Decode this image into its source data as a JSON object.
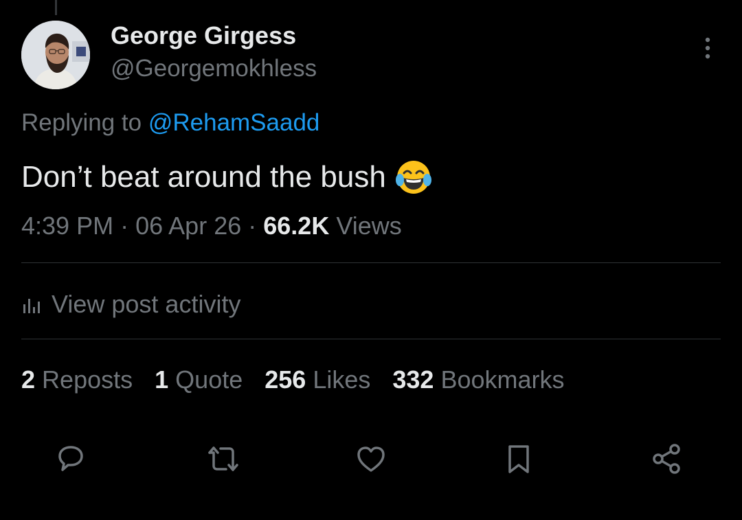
{
  "author": {
    "name": "George Girgess",
    "handle": "@Georgemokhless"
  },
  "reply": {
    "prefix": "Replying to ",
    "mention": "@RehamSaadd"
  },
  "tweet": {
    "text": "Don’t beat around the bush",
    "emoji": "face-with-tears-of-joy"
  },
  "meta": {
    "time": "4:39 PM",
    "separator": "·",
    "date": "06 Apr 26",
    "views_count": "66.2K",
    "views_label": "Views"
  },
  "activity": {
    "label": "View post activity",
    "icon": "analytics-icon"
  },
  "stats": [
    {
      "num": "2",
      "label": "Reposts"
    },
    {
      "num": "1",
      "label": "Quote"
    },
    {
      "num": "256",
      "label": "Likes"
    },
    {
      "num": "332",
      "label": "Bookmarks"
    }
  ],
  "actions": [
    {
      "name": "reply",
      "icon": "reply-icon"
    },
    {
      "name": "repost",
      "icon": "repost-icon"
    },
    {
      "name": "like",
      "icon": "heart-icon"
    },
    {
      "name": "bookmark",
      "icon": "bookmark-icon"
    },
    {
      "name": "share",
      "icon": "share-icon"
    }
  ],
  "colors": {
    "background": "#000000",
    "primary_text": "#e7e9ea",
    "secondary_text": "#71767b",
    "link": "#1d9bf0",
    "divider": "#2f3336"
  }
}
